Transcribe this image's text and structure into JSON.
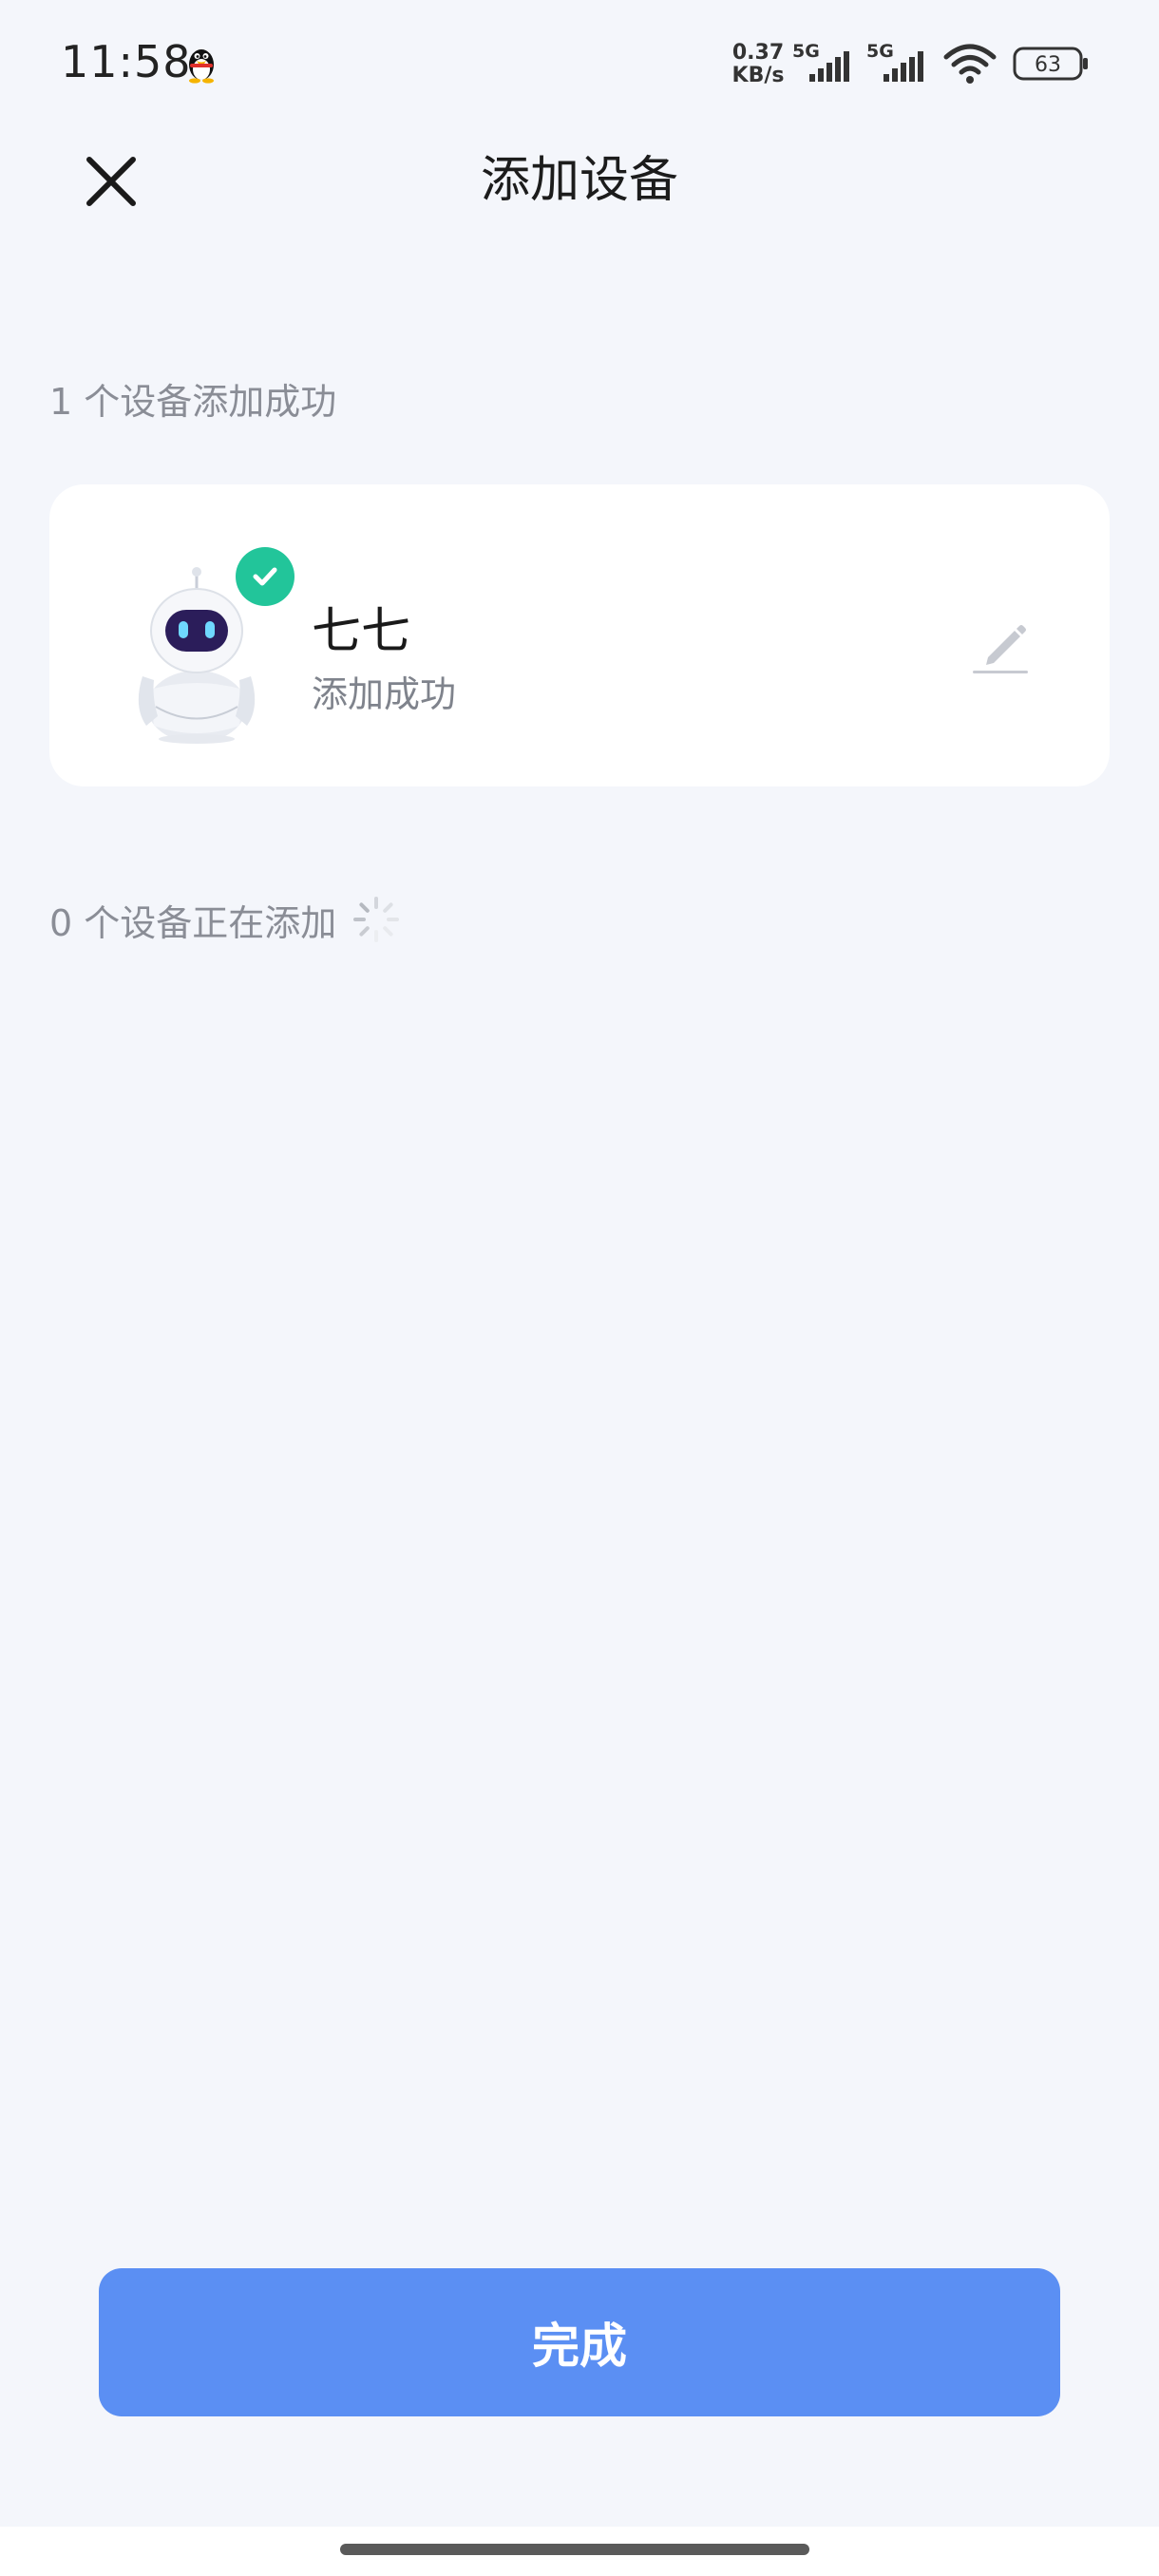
{
  "status_bar": {
    "time": "11:58",
    "net_speed_value": "0.37",
    "net_speed_unit": "KB/s",
    "sim1_type": "5G",
    "sim2_type": "5G",
    "battery_level": "63",
    "notification_icon": "qq-penguin-icon"
  },
  "header": {
    "title": "添加设备",
    "close_icon": "close-icon"
  },
  "success_section": {
    "label": "1 个设备添加成功",
    "devices": [
      {
        "name": "七七",
        "status": "添加成功",
        "icon": "robot-device-icon",
        "badge": "check-icon",
        "action_icon": "edit-pencil-icon"
      }
    ]
  },
  "adding_section": {
    "label": "0 个设备正在添加",
    "icon": "loading-spinner-icon"
  },
  "footer": {
    "done_label": "完成"
  },
  "colors": {
    "background": "#f4f6fb",
    "card": "#ffffff",
    "accent": "#5b8ff3",
    "success_badge": "#22c59a",
    "muted_text": "#8a8d96"
  }
}
